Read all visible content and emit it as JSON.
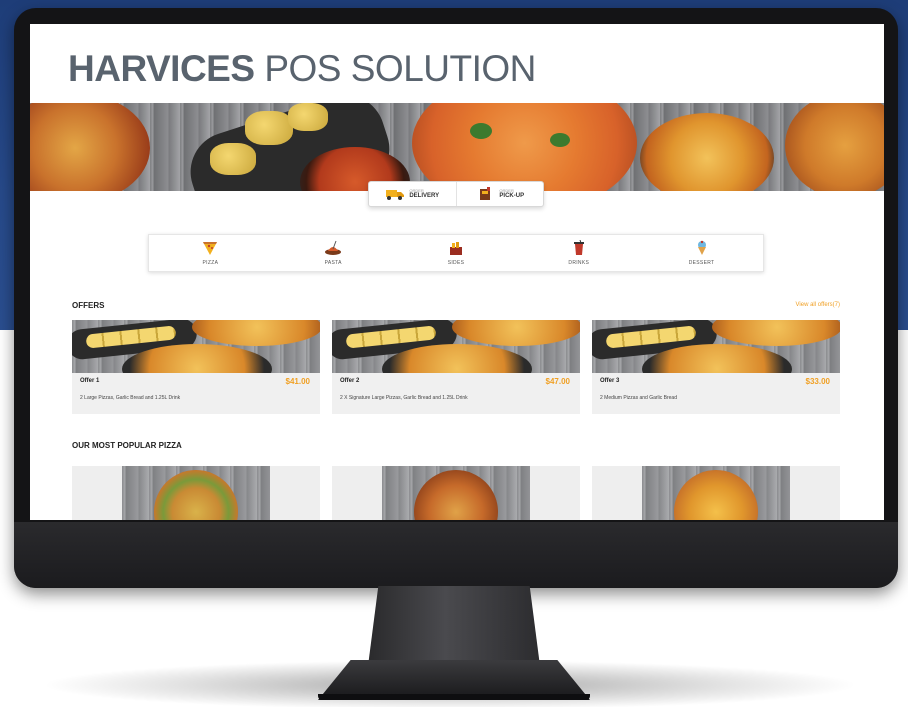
{
  "brand": {
    "bold": "HARVICES",
    "rest": "POS SOLUTION"
  },
  "order_type": {
    "options": [
      {
        "small": "ORDER",
        "main": "DELIVERY",
        "icon": "delivery-truck-icon"
      },
      {
        "small": "ORDER",
        "main": "PICK-UP",
        "icon": "pickup-bag-icon"
      }
    ]
  },
  "categories": [
    {
      "label": "PIZZA",
      "icon": "pizza-slice-icon"
    },
    {
      "label": "PASTA",
      "icon": "pasta-plate-icon"
    },
    {
      "label": "SIDES",
      "icon": "sides-basket-icon"
    },
    {
      "label": "DRINKS",
      "icon": "drink-cup-icon"
    },
    {
      "label": "DESSERT",
      "icon": "dessert-icon"
    }
  ],
  "offers": {
    "title": "OFFERS",
    "view_all": "View all offers(7)",
    "items": [
      {
        "name": "Offer 1",
        "price": "$41.00",
        "desc": "2 Large Pizzas, Garlic Bread and 1.25L Drink"
      },
      {
        "name": "Offer 2",
        "price": "$47.00",
        "desc": "2 X Signature Large Pizzas, Garlic Bread and 1.25L Drink"
      },
      {
        "name": "Offer 3",
        "price": "$33.00",
        "desc": "2 Medium Pizzas and Garlic Bread"
      }
    ]
  },
  "popular": {
    "title": "OUR MOST POPULAR PIZZA"
  },
  "colors": {
    "accent": "#f0a024",
    "brand_text": "#59636e",
    "backdrop_blue": "#1e3d78"
  }
}
